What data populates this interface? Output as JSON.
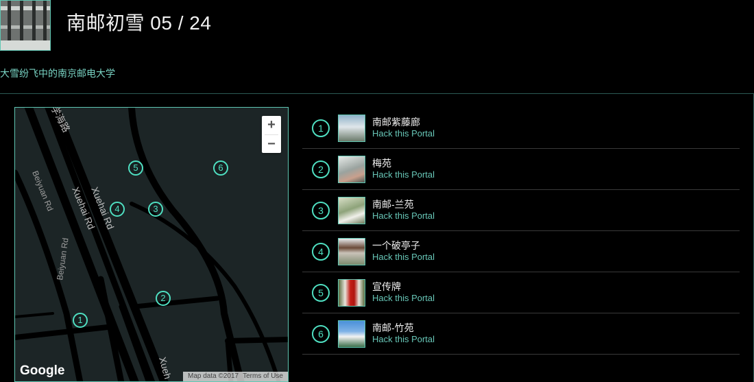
{
  "header": {
    "title": "南邮初雪 05 / 24",
    "subtitle": "大雪纷飞中的南京邮电大学"
  },
  "map": {
    "road_labels": [
      "Xuehai Rd",
      "Xuehai Rd",
      "Beiyuan Rd",
      "Beiyuan Rd",
      "学海路",
      "Xueh"
    ],
    "zoom_in": "+",
    "zoom_out": "−",
    "logo": "Google",
    "attribution": [
      "Map data ©2017",
      "Terms of Use"
    ],
    "markers": [
      "1",
      "2",
      "3",
      "4",
      "5",
      "6"
    ]
  },
  "portals": [
    {
      "num": "1",
      "name": "南邮紫藤廊",
      "action": "Hack this Portal"
    },
    {
      "num": "2",
      "name": "梅苑",
      "action": "Hack this Portal"
    },
    {
      "num": "3",
      "name": "南邮-兰苑",
      "action": "Hack this Portal"
    },
    {
      "num": "4",
      "name": "一个破亭子",
      "action": "Hack this Portal"
    },
    {
      "num": "5",
      "name": "宣传牌",
      "action": "Hack this Portal"
    },
    {
      "num": "6",
      "name": "南邮-竹苑",
      "action": "Hack this Portal"
    }
  ],
  "colors": {
    "accent": "#4fe0c2",
    "link": "#68c7b8",
    "background": "#000000",
    "map_bg": "#1c2526"
  }
}
